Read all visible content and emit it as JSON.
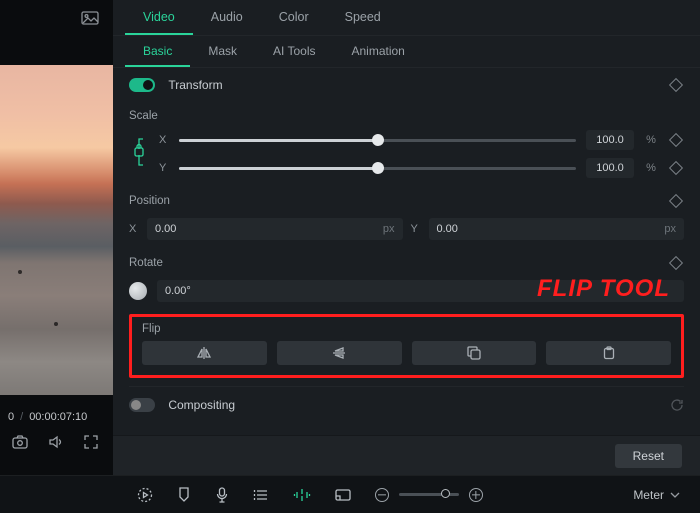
{
  "annotation": {
    "text": "FLIP TOOL",
    "color": "#ff1e1e"
  },
  "preview": {
    "current_time": "0",
    "total_time": "00:00:07:10"
  },
  "inspector": {
    "main_tabs": [
      {
        "label": "Video",
        "active": true
      },
      {
        "label": "Audio",
        "active": false
      },
      {
        "label": "Color",
        "active": false
      },
      {
        "label": "Speed",
        "active": false
      }
    ],
    "sub_tabs": [
      {
        "label": "Basic",
        "active": true
      },
      {
        "label": "Mask",
        "active": false
      },
      {
        "label": "AI Tools",
        "active": false
      },
      {
        "label": "Animation",
        "active": false
      }
    ],
    "transform": {
      "label": "Transform",
      "enabled": true
    },
    "scale": {
      "label": "Scale",
      "x": {
        "label": "X",
        "value": "100.0",
        "unit": "%"
      },
      "y": {
        "label": "Y",
        "value": "100.0",
        "unit": "%"
      }
    },
    "position": {
      "label": "Position",
      "x": {
        "label": "X",
        "value": "0.00",
        "unit": "px"
      },
      "y": {
        "label": "Y",
        "value": "0.00",
        "unit": "px"
      }
    },
    "rotate": {
      "label": "Rotate",
      "value": "0.00°"
    },
    "flip": {
      "label": "Flip"
    },
    "compositing": {
      "label": "Compositing",
      "enabled": false
    },
    "reset_label": "Reset"
  },
  "bottom_bar": {
    "meter_label": "Meter"
  }
}
